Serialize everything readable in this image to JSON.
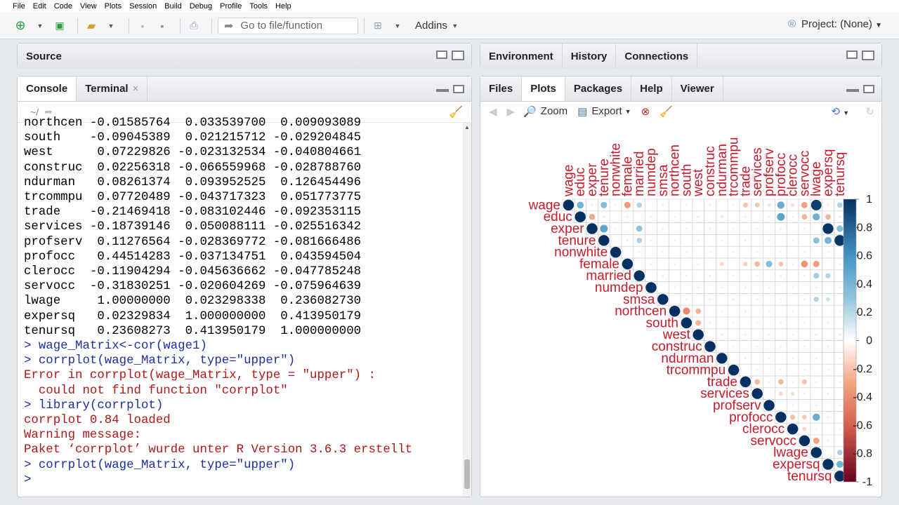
{
  "menu": [
    "File",
    "Edit",
    "Code",
    "View",
    "Plots",
    "Session",
    "Build",
    "Debug",
    "Profile",
    "Tools",
    "Help"
  ],
  "toolbar": {
    "goto_placeholder": "Go to file/function",
    "addins": "Addins",
    "project": "Project: (None)"
  },
  "source_pane": {
    "title": "Source"
  },
  "console_pane": {
    "tabs": [
      "Console",
      "Terminal"
    ],
    "path": "~/",
    "lines": [
      {
        "t": "northcen -0.01585764  0.033539700  0.009093089",
        "c": "out"
      },
      {
        "t": "south    -0.09045389  0.021215712 -0.029204845",
        "c": "out"
      },
      {
        "t": "west      0.07229826 -0.023132534 -0.040804661",
        "c": "out"
      },
      {
        "t": "construc  0.02256318 -0.066559968 -0.028788760",
        "c": "out"
      },
      {
        "t": "ndurman   0.08261374  0.093952525  0.126454496",
        "c": "out"
      },
      {
        "t": "trcommpu  0.07720489 -0.043717323  0.051773775",
        "c": "out"
      },
      {
        "t": "trade    -0.21469418 -0.083102446 -0.092353115",
        "c": "out"
      },
      {
        "t": "services -0.18739146  0.050088111 -0.025516342",
        "c": "out"
      },
      {
        "t": "profserv  0.11276564 -0.028369772 -0.081666486",
        "c": "out"
      },
      {
        "t": "profocc   0.44514283 -0.037134751  0.043594504",
        "c": "out"
      },
      {
        "t": "clerocc  -0.11904294 -0.045636662 -0.047785248",
        "c": "out"
      },
      {
        "t": "servocc  -0.31830251 -0.020604269 -0.075964639",
        "c": "out"
      },
      {
        "t": "lwage     1.00000000  0.023298338  0.236082730",
        "c": "out"
      },
      {
        "t": "expersq   0.02329834  1.000000000  0.413950179",
        "c": "out"
      },
      {
        "t": "tenursq   0.23608273  0.413950179  1.000000000",
        "c": "out"
      },
      {
        "t": "> wage_Matrix<-cor(wage1)",
        "c": "prompt"
      },
      {
        "t": "> corrplot(wage_Matrix, type=\"upper\")",
        "c": "prompt"
      },
      {
        "t": "Error in corrplot(wage_Matrix, type = \"upper\") :",
        "c": "err"
      },
      {
        "t": "  could not find function \"corrplot\"",
        "c": "err"
      },
      {
        "t": "> library(corrplot)",
        "c": "prompt"
      },
      {
        "t": "corrplot 0.84 loaded",
        "c": "err"
      },
      {
        "t": "Warning message:",
        "c": "err"
      },
      {
        "t": "Paket ‘corrplot’ wurde unter R Version 3.6.3 erstellt",
        "c": "err"
      },
      {
        "t": "> corrplot(wage_Matrix, type=\"upper\")",
        "c": "prompt"
      },
      {
        "t": ">",
        "c": "prompt"
      }
    ]
  },
  "env_pane": {
    "tabs": [
      "Environment",
      "History",
      "Connections"
    ]
  },
  "files_pane": {
    "tabs": [
      "Files",
      "Plots",
      "Packages",
      "Help",
      "Viewer"
    ],
    "zoom": "Zoom",
    "export": "Export"
  },
  "chart_data": {
    "type": "heatmap",
    "variables": [
      "wage",
      "educ",
      "exper",
      "tenure",
      "nonwhite",
      "female",
      "married",
      "numdep",
      "smsa",
      "northcen",
      "south",
      "west",
      "construc",
      "ndurman",
      "trcommpu",
      "trade",
      "services",
      "profserv",
      "profocc",
      "clerocc",
      "servocc",
      "lwage",
      "expersq",
      "tenursq"
    ],
    "upper_offdiag": [
      {
        "i": 0,
        "j": 1,
        "v": 0.4
      },
      {
        "i": 0,
        "j": 3,
        "v": 0.35
      },
      {
        "i": 0,
        "j": 5,
        "v": -0.34
      },
      {
        "i": 0,
        "j": 6,
        "v": 0.23
      },
      {
        "i": 0,
        "j": 15,
        "v": -0.21
      },
      {
        "i": 0,
        "j": 16,
        "v": -0.19
      },
      {
        "i": 0,
        "j": 17,
        "v": 0.11
      },
      {
        "i": 0,
        "j": 18,
        "v": 0.45
      },
      {
        "i": 0,
        "j": 19,
        "v": -0.12
      },
      {
        "i": 0,
        "j": 20,
        "v": -0.32
      },
      {
        "i": 0,
        "j": 21,
        "v": 0.94
      },
      {
        "i": 0,
        "j": 23,
        "v": 0.24
      },
      {
        "i": 1,
        "j": 2,
        "v": -0.3
      },
      {
        "i": 1,
        "j": 13,
        "v": 0.09
      },
      {
        "i": 1,
        "j": 18,
        "v": 0.5
      },
      {
        "i": 1,
        "j": 20,
        "v": -0.25
      },
      {
        "i": 1,
        "j": 21,
        "v": 0.43
      },
      {
        "i": 1,
        "j": 22,
        "v": -0.25
      },
      {
        "i": 2,
        "j": 3,
        "v": 0.5
      },
      {
        "i": 2,
        "j": 6,
        "v": 0.32
      },
      {
        "i": 2,
        "j": 22,
        "v": 0.98
      },
      {
        "i": 2,
        "j": 23,
        "v": 0.35
      },
      {
        "i": 3,
        "j": 6,
        "v": 0.24
      },
      {
        "i": 3,
        "j": 21,
        "v": 0.33
      },
      {
        "i": 3,
        "j": 22,
        "v": 0.41
      },
      {
        "i": 3,
        "j": 23,
        "v": 0.98
      },
      {
        "i": 5,
        "j": 13,
        "v": -0.14
      },
      {
        "i": 5,
        "j": 15,
        "v": -0.16
      },
      {
        "i": 5,
        "j": 16,
        "v": -0.24
      },
      {
        "i": 5,
        "j": 17,
        "v": 0.35
      },
      {
        "i": 5,
        "j": 18,
        "v": -0.2
      },
      {
        "i": 5,
        "j": 20,
        "v": -0.38
      },
      {
        "i": 5,
        "j": 21,
        "v": -0.34
      },
      {
        "i": 6,
        "j": 21,
        "v": 0.27
      },
      {
        "i": 6,
        "j": 22,
        "v": 0.22
      },
      {
        "i": 8,
        "j": 21,
        "v": 0.22
      },
      {
        "i": 8,
        "j": 22,
        "v": 0.15
      },
      {
        "i": 9,
        "j": 10,
        "v": -0.43
      },
      {
        "i": 9,
        "j": 11,
        "v": -0.26
      },
      {
        "i": 10,
        "j": 11,
        "v": -0.26
      },
      {
        "i": 15,
        "j": 16,
        "v": -0.24
      },
      {
        "i": 15,
        "j": 18,
        "v": -0.24
      },
      {
        "i": 15,
        "j": 20,
        "v": -0.21
      },
      {
        "i": 16,
        "j": 18,
        "v": -0.14
      },
      {
        "i": 16,
        "j": 19,
        "v": -0.12
      },
      {
        "i": 18,
        "j": 19,
        "v": -0.22
      },
      {
        "i": 18,
        "j": 20,
        "v": -0.18
      },
      {
        "i": 18,
        "j": 21,
        "v": 0.45
      },
      {
        "i": 19,
        "j": 20,
        "v": -0.14
      },
      {
        "i": 20,
        "j": 21,
        "v": -0.32
      },
      {
        "i": 21,
        "j": 23,
        "v": 0.24
      },
      {
        "i": 22,
        "j": 23,
        "v": 0.41
      }
    ],
    "colorbar_ticks": [
      "1",
      "0.8",
      "0.6",
      "0.4",
      "0.2",
      "0",
      "-0.2",
      "-0.4",
      "-0.6",
      "-0.8",
      "-1"
    ],
    "vmin": -1,
    "vmax": 1
  }
}
